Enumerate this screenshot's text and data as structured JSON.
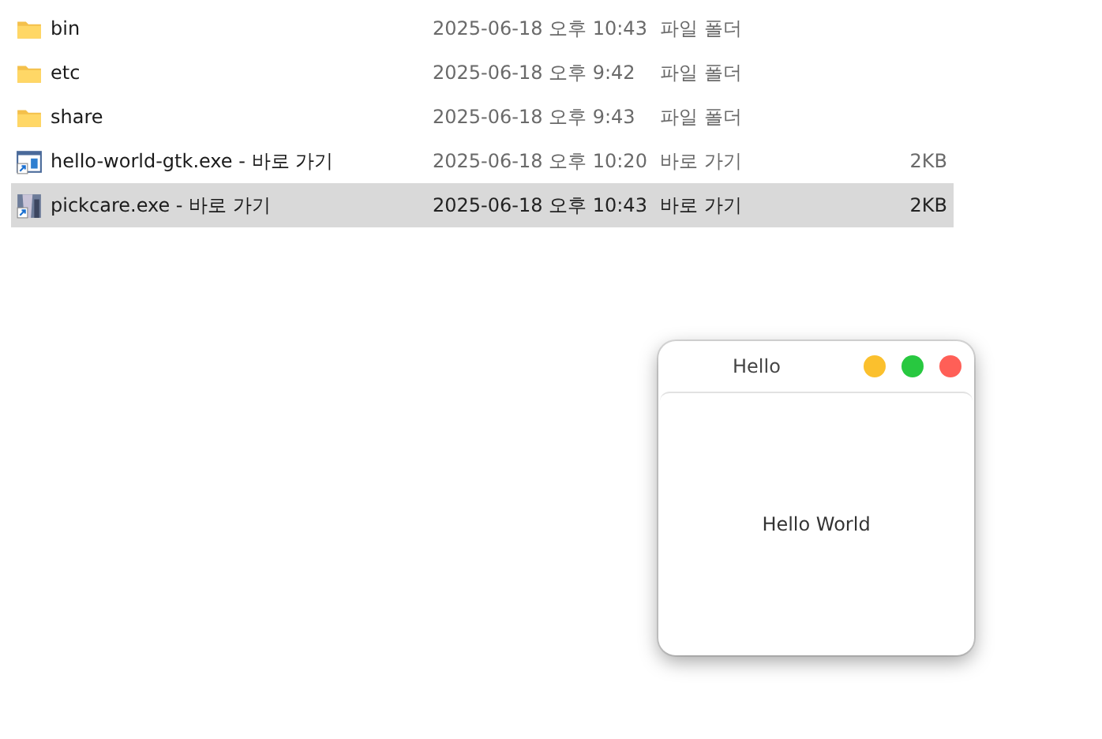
{
  "files": [
    {
      "name": "bin",
      "modified": "2025-06-18 오후 10:43",
      "type": "파일 폴더",
      "kind": "folder",
      "selected": false
    },
    {
      "name": "etc",
      "modified": "2025-06-18 오후 9:42",
      "type": "파일 폴더",
      "kind": "folder",
      "selected": false
    },
    {
      "name": "share",
      "modified": "2025-06-18 오후 9:43",
      "type": "파일 폴더",
      "kind": "folder",
      "selected": false
    },
    {
      "name": "hello-world-gtk.exe - 바로 가기",
      "modified": "2025-06-18 오후 10:20",
      "type": "바로 가기",
      "size": "2KB",
      "kind": "app-shortcut",
      "selected": false
    },
    {
      "name": "pickcare.exe - 바로 가기",
      "modified": "2025-06-18 오후 10:43",
      "type": "바로 가기",
      "size": "2KB",
      "kind": "image-shortcut",
      "selected": true
    }
  ],
  "window": {
    "title": "Hello",
    "buttons": [
      {
        "color": "#fbc02d"
      },
      {
        "color": "#28c840"
      },
      {
        "color": "#ff5f57"
      }
    ],
    "body": "Hello World"
  }
}
